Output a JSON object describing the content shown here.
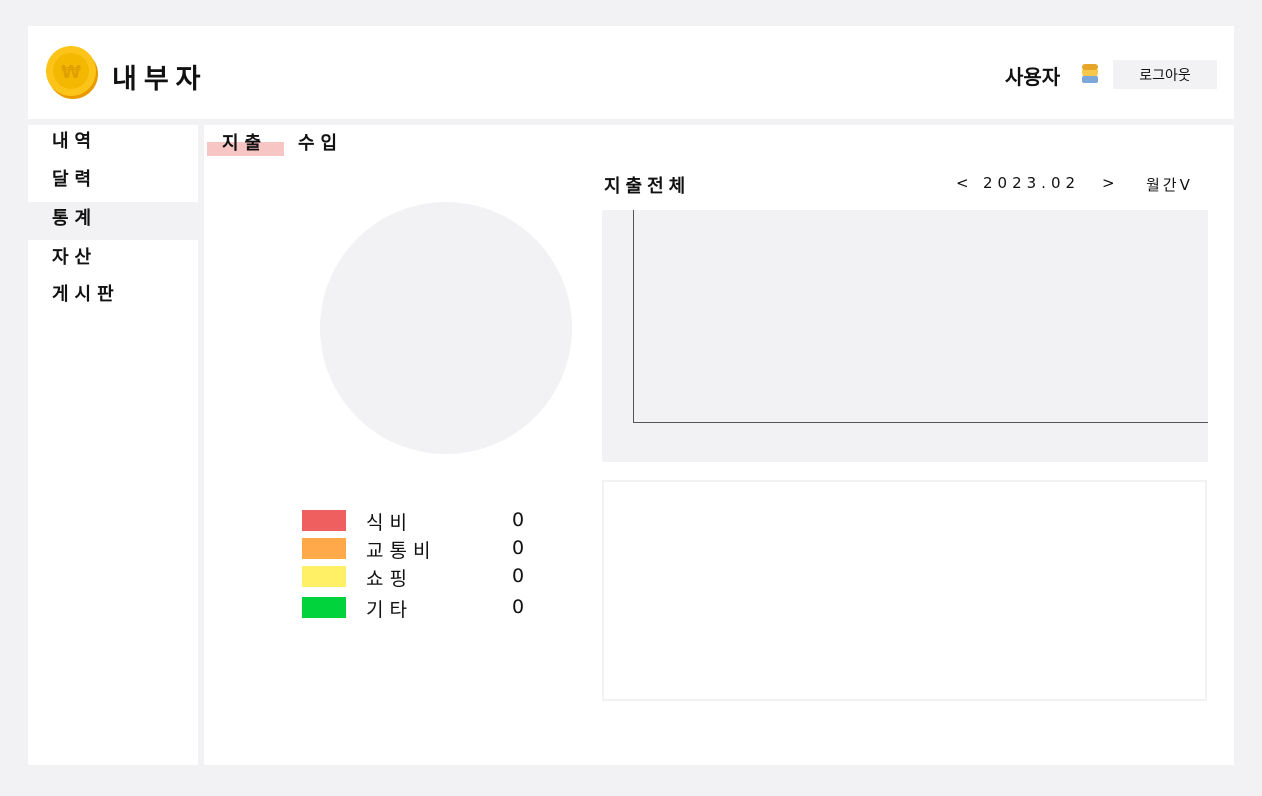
{
  "header": {
    "brand": "내부자",
    "user_label": "사용자",
    "user_icon": "person-emoji-icon",
    "logout_label": "로그아웃",
    "logo_icon": "won-coin-icon"
  },
  "sidebar": {
    "items": [
      {
        "label": "내역",
        "active": false
      },
      {
        "label": "달력",
        "active": false
      },
      {
        "label": "통계",
        "active": true
      },
      {
        "label": "자산",
        "active": false
      },
      {
        "label": "게시판",
        "active": false
      }
    ]
  },
  "tabs": [
    {
      "label": "지출",
      "active": true
    },
    {
      "label": "수입",
      "active": false
    }
  ],
  "legend": [
    {
      "label": "식비",
      "value": "0",
      "color": "#ef5f5f"
    },
    {
      "label": "교통비",
      "value": "0",
      "color": "#ffa94a"
    },
    {
      "label": "쇼핑",
      "value": "0",
      "color": "#fff065"
    },
    {
      "label": "기타",
      "value": "0",
      "color": "#00d33b"
    }
  ],
  "chart": {
    "title": "지출전체",
    "prev_label": "<",
    "month": "2023.02",
    "next_label": ">",
    "period_label": "월간V"
  },
  "colors": {
    "background": "#f2f2f4",
    "tab_underline": "#f6c5c4",
    "coin": "#f5b800"
  }
}
